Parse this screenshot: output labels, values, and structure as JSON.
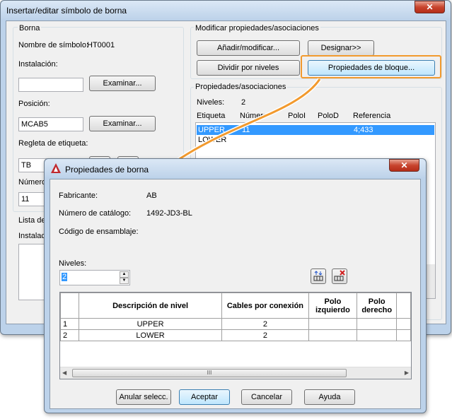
{
  "main_window": {
    "title": "Insertar/editar símbolo de borna",
    "close": "✕",
    "borna": {
      "group": "Borna",
      "symbol_name_label": "Nombre de símbolo:",
      "symbol_name_value": "HT0001",
      "installation_label": "Instalación:",
      "installation_value": "",
      "browse1": "Examinar...",
      "position_label": "Posición:",
      "position_value": "MCAB5",
      "browse2": "Examinar...",
      "strip_label": "Regleta de etiqueta:",
      "strip_value": "TB",
      "number_label": "Número",
      "number_value": "11",
      "list_label": "Lista de",
      "installation2_label": "Instalació"
    },
    "modify": {
      "group": "Modificar propiedades/asociaciones",
      "add_modify": "Añadir/modificar...",
      "designate": "Designar>>",
      "split_levels": "Dividir por niveles",
      "block_props": "Propiedades de bloque..."
    },
    "props": {
      "group": "Propiedades/asociaciones",
      "levels_label": "Niveles:",
      "levels_value": "2",
      "columns": [
        "Etiqueta",
        "Número",
        "PoloI",
        "PoloD",
        "Referencia"
      ],
      "rows": [
        {
          "label": "UPPER",
          "number": "11",
          "pi": "",
          "pd": "",
          "ref": "4;433"
        },
        {
          "label": "LOWER",
          "number": "",
          "pi": "",
          "pd": "",
          "ref": ""
        }
      ]
    }
  },
  "dialog": {
    "title": "Propiedades de borna",
    "close": "✕",
    "manufacturer_label": "Fabricante:",
    "manufacturer_value": "AB",
    "catalog_label": "Número de catálogo:",
    "catalog_value": "1492-JD3-BL",
    "assembly_label": "Código de ensamblaje:",
    "levels_label": "Niveles:",
    "levels_value": "2",
    "table": {
      "headers": [
        "Descripción de nivel",
        "Cables por conexión",
        "Polo izquierdo",
        "Polo derecho"
      ],
      "rows": [
        {
          "index": "1",
          "desc": "UPPER",
          "cables": "2"
        },
        {
          "index": "2",
          "desc": "LOWER",
          "cables": "2"
        }
      ]
    },
    "scroll_grip": "III",
    "buttons": {
      "clear": "Anular selecc.",
      "ok": "Aceptar",
      "cancel": "Cancelar",
      "help": "Ayuda"
    }
  },
  "colors": {
    "highlight": "#f29a2e",
    "selection": "#3399ff"
  }
}
